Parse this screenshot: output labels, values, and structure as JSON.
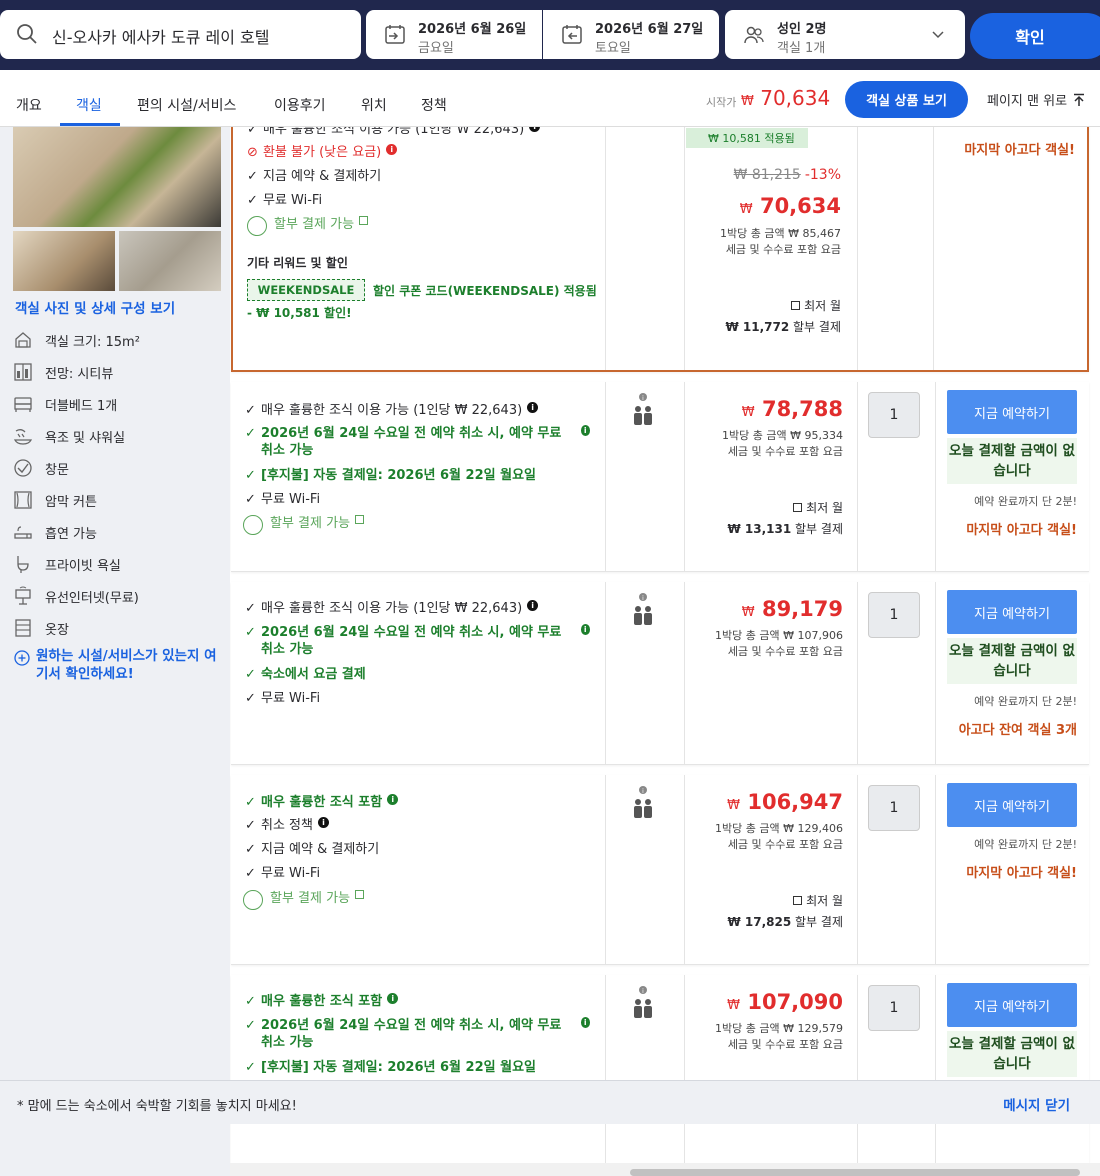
{
  "search": {
    "destination": "신-오사카 에사카 도큐 레이 호텔",
    "checkin_date": "2026년 6월 26일",
    "checkin_day": "금요일",
    "checkout_date": "2026년 6월 27일",
    "checkout_day": "토요일",
    "adults": "성인 2명",
    "rooms": "객실 1개",
    "confirm": "확인"
  },
  "tabs": [
    "개요",
    "객실",
    "편의 시설/서비스",
    "이용후기",
    "위치",
    "정책"
  ],
  "active_tab": "객실",
  "header_price": {
    "label": "시작가",
    "currency": "₩",
    "amount": "70,634",
    "view_rooms": "객실 상품 보기",
    "to_top": "페이지 맨 위로"
  },
  "left_panel": {
    "room_link": "객실 사진 및 상세 구성 보기",
    "amenities": [
      {
        "icon": "room-size-icon",
        "label": "객실 크기: 15m²"
      },
      {
        "icon": "city-view-icon",
        "label": "전망: 시티뷰"
      },
      {
        "icon": "bed-icon",
        "label": "더블베드 1개"
      },
      {
        "icon": "shower-icon",
        "label": "욕조 및 샤워실"
      },
      {
        "icon": "window-icon",
        "label": "창문"
      },
      {
        "icon": "curtain-icon",
        "label": "암막 커튼"
      },
      {
        "icon": "smoking-icon",
        "label": "흡연 가능"
      },
      {
        "icon": "bathroom-icon",
        "label": "프라이빗 욕실"
      },
      {
        "icon": "lan-icon",
        "label": "유선인터넷(무료)"
      },
      {
        "icon": "closet-icon",
        "label": "옷장"
      }
    ],
    "facility_link": "원하는 시설/서비스가 있는지 여기서 확인하세요!"
  },
  "first_row": {
    "feature_top": "매우 훌륭한 조식 이용 가능 (1인당 ₩ 22,643)",
    "nonrefundable": "환불 불가 (낮은 요금)",
    "pay_now": "지금 예약 & 결제하기",
    "wifi": "무료 Wi-Fi",
    "installment": "할부 결제 가능",
    "rewards_title": "기타 리워드 및 할인",
    "coupon_code": "WEEKENDSALE",
    "coupon_text": "할인 쿠폰 코드(WEEKENDSALE) 적용됨",
    "coupon_saving": "- ₩ 10,581 할인!",
    "discount_badge": "₩ 10,581 적용됨",
    "original_price": "₩ 81,215",
    "discount_pct": "-13%",
    "price": "70,634",
    "per_night": "1박당 총 금액 ₩ 85,467",
    "tax_note": "세금 및 수수료 포함 요금",
    "lowest_monthly_label": "최저 월",
    "lowest_monthly": "₩ 11,772",
    "installment_label": "할부 결제",
    "scarcity": "마지막 아고다 객실!"
  },
  "rows": [
    {
      "features": [
        {
          "type": "check",
          "text": "매우 훌륭한 조식 이용 가능 (1인당 ₩ 22,643)",
          "info": "black"
        },
        {
          "type": "green",
          "text": "2026년 6월 24일 수요일 전 예약 취소 시, 예약 무료 취소 가능",
          "info": "green"
        },
        {
          "type": "green",
          "text": "[후지불] 자동 결제일: 2026년 6월 22일 월요일"
        },
        {
          "type": "check",
          "text": "무료 Wi-Fi"
        },
        {
          "type": "pay",
          "text": "할부 결제 가능"
        }
      ],
      "price": "78,788",
      "per_night": "1박당 총 금액 ₩ 95,334",
      "tax_note": "세금 및 수수료 포함 요금",
      "lowest_monthly_label": "최저 월",
      "lowest_monthly": "₩ 13,131",
      "installment_label": "할부 결제",
      "qty": "1",
      "book": "지금 예약하기",
      "no_pay": "오늘 결제할 금액이 없습니다",
      "urgency": "예약 완료까지 단 2분!",
      "scarcity": "마지막 아고다 객실!"
    },
    {
      "features": [
        {
          "type": "check",
          "text": "매우 훌륭한 조식 이용 가능 (1인당 ₩ 22,643)",
          "info": "black"
        },
        {
          "type": "green",
          "text": "2026년 6월 24일 수요일 전 예약 취소 시, 예약 무료 취소 가능",
          "info": "green"
        },
        {
          "type": "green",
          "text": "숙소에서 요금 결제"
        },
        {
          "type": "check",
          "text": "무료 Wi-Fi"
        }
      ],
      "price": "89,179",
      "per_night": "1박당 총 금액 ₩ 107,906",
      "tax_note": "세금 및 수수료 포함 요금",
      "qty": "1",
      "book": "지금 예약하기",
      "no_pay": "오늘 결제할 금액이 없습니다",
      "urgency": "예약 완료까지 단 2분!",
      "scarcity": "아고다 잔여 객실 3개"
    },
    {
      "features": [
        {
          "type": "green",
          "text": "매우 훌륭한 조식 포함",
          "info": "green"
        },
        {
          "type": "check",
          "text": "취소 정책",
          "info": "black"
        },
        {
          "type": "check",
          "text": "지금 예약 & 결제하기"
        },
        {
          "type": "check",
          "text": "무료 Wi-Fi"
        },
        {
          "type": "pay",
          "text": "할부 결제 가능"
        }
      ],
      "price": "106,947",
      "per_night": "1박당 총 금액 ₩ 129,406",
      "tax_note": "세금 및 수수료 포함 요금",
      "lowest_monthly_label": "최저 월",
      "lowest_monthly": "₩ 17,825",
      "installment_label": "할부 결제",
      "qty": "1",
      "book": "지금 예약하기",
      "urgency": "예약 완료까지 단 2분!",
      "scarcity": "마지막 아고다 객실!"
    },
    {
      "features": [
        {
          "type": "green",
          "text": "매우 훌륭한 조식 포함",
          "info": "green"
        },
        {
          "type": "green",
          "text": "2026년 6월 24일 수요일 전 예약 취소 시, 예약 무료 취소 가능",
          "info": "green"
        },
        {
          "type": "green",
          "text": "[후지불] 자동 결제일: 2026년 6월 22일 월요일"
        }
      ],
      "price": "107,090",
      "per_night": "1박당 총 금액 ₩ 129,579",
      "tax_note": "세금 및 수수료 포함 요금",
      "qty": "1",
      "book": "지금 예약하기",
      "no_pay": "오늘 결제할 금액이 없습니다"
    }
  ],
  "currency_symbol": "₩",
  "message_bar": {
    "text": "* 맘에 드는 숙소에서 숙박할 기회를 놓치지 마세요!",
    "close": "메시지 닫기"
  },
  "colors": {
    "header_bg": "#20274d",
    "accent": "#1a62e0",
    "price_red": "#e12d2d",
    "green": "#1c7f2c",
    "scarcity": "#c74e19",
    "highlight_border": "#c7672f"
  }
}
